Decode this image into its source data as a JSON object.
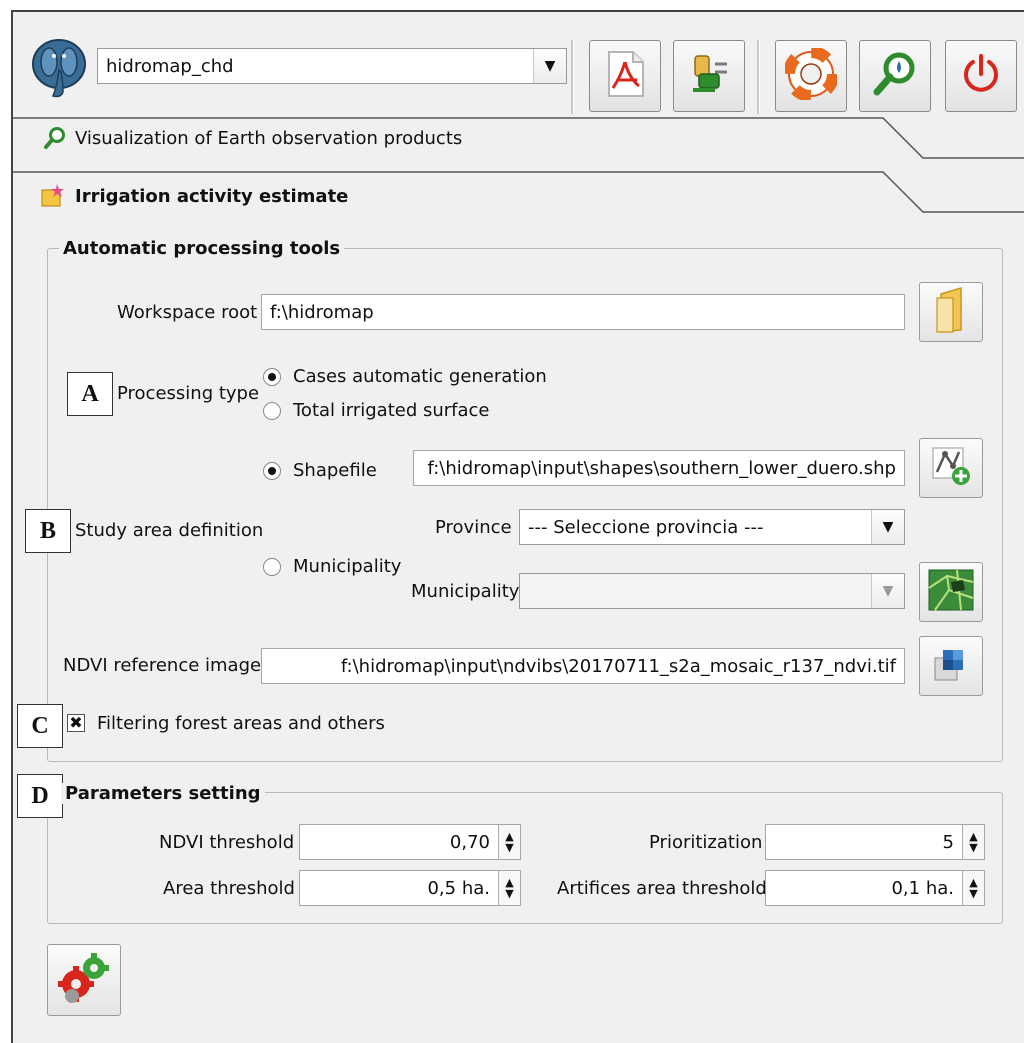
{
  "toolbar": {
    "database_value": "hidromap_chd",
    "icons": [
      "database-elephant-icon",
      "pdf-icon",
      "tools-icon",
      "help-lifebuoy-icon",
      "zoom-icon",
      "power-icon"
    ]
  },
  "tabs": {
    "visualization_label": "Visualization of Earth observation products",
    "irrigation_label": "Irrigation activity estimate"
  },
  "automatic": {
    "title": "Automatic processing tools",
    "workspace_label": "Workspace root",
    "workspace_value": "f:\\hidromap",
    "processing_type_label": "Processing type",
    "processing_options": [
      "Cases automatic generation",
      "Total irrigated surface"
    ],
    "processing_selected": "Cases automatic generation",
    "study_area_label": "Study area definition",
    "shapefile_label": "Shapefile",
    "shapefile_value": "f:\\hidromap\\input\\shapes\\southern_lower_duero.shp",
    "province_label": "Province",
    "province_value": "--- Seleccione provincia ---",
    "municipality_radio_label": "Municipality",
    "municipality_label": "Municipality",
    "municipality_value": "",
    "ndvi_ref_label": "NDVI reference image",
    "ndvi_ref_value": "f:\\hidromap\\input\\ndvibs\\20170711_s2a_mosaic_r137_ndvi.tif",
    "filter_label": "Filtering forest areas and others",
    "filter_checked": true
  },
  "params": {
    "title": "Parameters setting",
    "ndvi_threshold_label": "NDVI threshold",
    "ndvi_threshold_value": "0,70",
    "area_threshold_label": "Area threshold",
    "area_threshold_value": "0,5 ha.",
    "prioritization_label": "Prioritization",
    "prioritization_value": "5",
    "artifices_label": "Artifices area threshold",
    "artifices_value": "0,1 ha."
  },
  "annotations": {
    "a": "A",
    "b": "B",
    "c": "C",
    "d": "D"
  },
  "colors": {
    "panel_bg": "#f0f0f0",
    "accent_red": "#d9261c",
    "accent_green": "#2e8b2e"
  }
}
